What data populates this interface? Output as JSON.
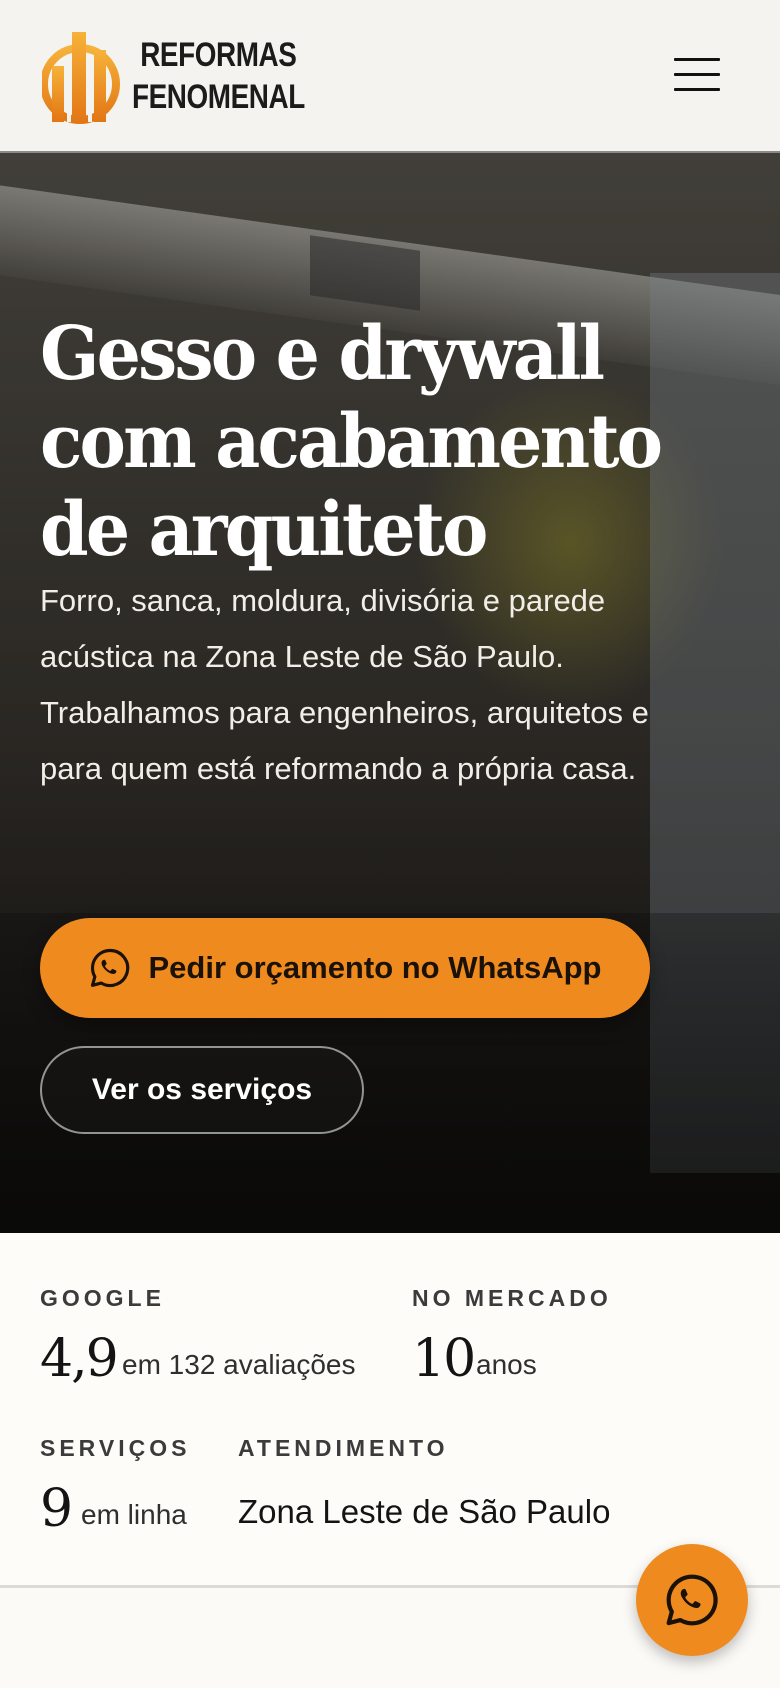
{
  "brand": {
    "name_line1": "REFORMAS",
    "name_line2": "FENOMENAL",
    "accent_color": "#ef8a1e"
  },
  "header": {
    "menu_icon": "hamburger-menu-icon"
  },
  "hero": {
    "title_lines": [
      "Gesso e drywall",
      "com acabamento",
      "de arquiteto"
    ],
    "subtitle_lines": [
      "Forro, sanca, moldura, divisória e parede",
      "acústica na Zona Leste de São Paulo.",
      "Trabalhamos para engenheiros, arquitetos e",
      "para quem está reformando a própria casa."
    ],
    "primary_cta": {
      "label": "Pedir orçamento no WhatsApp",
      "icon": "whatsapp-icon"
    },
    "secondary_cta": {
      "label": "Ver os serviços"
    }
  },
  "stats": {
    "google": {
      "label": "GOOGLE",
      "value": "4,9",
      "suffix": "em 132 avaliações"
    },
    "market": {
      "label": "NO MERCADO",
      "value": "10",
      "suffix": "anos"
    },
    "services": {
      "label": "SERVIÇOS",
      "value": "9",
      "suffix": "em linha"
    },
    "service_area": {
      "label": "ATENDIMENTO",
      "value": "Zona Leste de São Paulo"
    }
  },
  "floating_button": {
    "icon": "whatsapp-icon"
  }
}
